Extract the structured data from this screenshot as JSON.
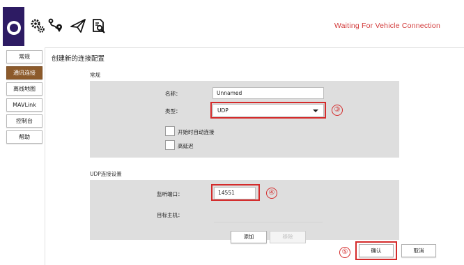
{
  "toolbar": {
    "status": "Waiting For Vehicle Connection",
    "icons": [
      "app-logo",
      "settings-gear-icon",
      "plan-route-icon",
      "fly-paper-plane-icon",
      "analyze-document-icon"
    ]
  },
  "sidebar": {
    "items": [
      {
        "label": "常规",
        "active": false
      },
      {
        "label": "通讯连接",
        "active": true
      },
      {
        "label": "离线地图",
        "active": false
      },
      {
        "label": "MAVLink",
        "active": false
      },
      {
        "label": "控制台",
        "active": false
      },
      {
        "label": "帮助",
        "active": false
      }
    ]
  },
  "main": {
    "title": "创建新的连接配置",
    "general_section": {
      "heading": "常规",
      "name_label": "名称：",
      "name_value": "Unnamed",
      "type_label": "类型：",
      "type_value": "UDP",
      "auto_connect_label": "开始时自动连接",
      "high_latency_label": "高延迟"
    },
    "udp_section": {
      "heading": "UDP连接设置",
      "port_label": "监听端口：",
      "port_value": "14551",
      "target_host_label": "目标主机：",
      "add_button": "添加",
      "remove_button": "移除"
    },
    "callouts": [
      "③",
      "④",
      "⑤"
    ],
    "ok_button": "确认",
    "cancel_button": "取消"
  },
  "colors": {
    "logo_bg": "#2d1b63",
    "active_tab": "#8c5a2b",
    "status_red": "#d23a3a",
    "callout_red": "#d42b2b",
    "panel_gray": "#dedede"
  }
}
